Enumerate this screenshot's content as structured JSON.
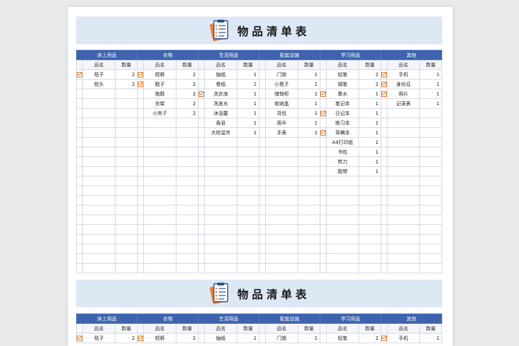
{
  "title": "物品清单表",
  "categories": [
    "床上用品",
    "衣物",
    "生活用品",
    "配套设施",
    "学习用品",
    "其他"
  ],
  "subheaders": {
    "name": "品名",
    "qty": "数量"
  },
  "rows": [
    [
      {
        "c": true,
        "n": "毯子",
        "q": "2"
      },
      {
        "c": true,
        "n": "短裤",
        "q": "2"
      },
      {
        "c": false,
        "n": "抽纸",
        "q": "1"
      },
      {
        "c": false,
        "n": "门锁",
        "q": "1"
      },
      {
        "c": false,
        "n": "铅笔",
        "q": "2"
      },
      {
        "c": true,
        "n": "手机",
        "q": "1"
      }
    ],
    [
      {
        "c": false,
        "n": "枕头",
        "q": "2"
      },
      {
        "c": true,
        "n": "鞋子",
        "q": "2"
      },
      {
        "c": false,
        "n": "卷纸",
        "q": "1"
      },
      {
        "c": false,
        "n": "小凳子",
        "q": "1"
      },
      {
        "c": false,
        "n": "钢笔",
        "q": "2"
      },
      {
        "c": true,
        "n": "身份证",
        "q": "1"
      }
    ],
    [
      {
        "c": false,
        "n": "",
        "q": ""
      },
      {
        "c": false,
        "n": "拖鞋",
        "q": "2"
      },
      {
        "c": true,
        "n": "洗衣液",
        "q": "1"
      },
      {
        "c": false,
        "n": "储物柜",
        "q": "1"
      },
      {
        "c": true,
        "n": "墨水",
        "q": "1"
      },
      {
        "c": true,
        "n": "照片",
        "q": "1"
      }
    ],
    [
      {
        "c": false,
        "n": "",
        "q": ""
      },
      {
        "c": false,
        "n": "衣架",
        "q": "2"
      },
      {
        "c": false,
        "n": "洗发水",
        "q": "1"
      },
      {
        "c": false,
        "n": "收纳盒",
        "q": "1"
      },
      {
        "c": false,
        "n": "笔记本",
        "q": "1"
      },
      {
        "c": false,
        "n": "记录表",
        "q": "1"
      }
    ],
    [
      {
        "c": false,
        "n": "",
        "q": ""
      },
      {
        "c": false,
        "n": "小夹子",
        "q": "2"
      },
      {
        "c": false,
        "n": "沐浴露",
        "q": "1"
      },
      {
        "c": false,
        "n": "背包",
        "q": "1"
      },
      {
        "c": true,
        "n": "日记本",
        "q": "1"
      },
      {
        "c": false,
        "n": "",
        "q": ""
      }
    ],
    [
      {
        "c": false,
        "n": "",
        "q": ""
      },
      {
        "c": false,
        "n": "",
        "q": ""
      },
      {
        "c": false,
        "n": "香皂",
        "q": "1"
      },
      {
        "c": false,
        "n": "雨伞",
        "q": "1"
      },
      {
        "c": false,
        "n": "练习本",
        "q": "1"
      },
      {
        "c": false,
        "n": "",
        "q": ""
      }
    ],
    [
      {
        "c": false,
        "n": "",
        "q": ""
      },
      {
        "c": false,
        "n": "",
        "q": ""
      },
      {
        "c": false,
        "n": "大绞溢市",
        "q": "1"
      },
      {
        "c": false,
        "n": "手表",
        "q": "1"
      },
      {
        "c": true,
        "n": "草稿本",
        "q": "1"
      },
      {
        "c": false,
        "n": "",
        "q": ""
      }
    ],
    [
      {
        "c": false,
        "n": "",
        "q": ""
      },
      {
        "c": false,
        "n": "",
        "q": ""
      },
      {
        "c": false,
        "n": "",
        "q": ""
      },
      {
        "c": false,
        "n": "",
        "q": ""
      },
      {
        "c": false,
        "n": "A4打印纸",
        "q": "1"
      },
      {
        "c": false,
        "n": "",
        "q": ""
      }
    ],
    [
      {
        "c": false,
        "n": "",
        "q": ""
      },
      {
        "c": false,
        "n": "",
        "q": ""
      },
      {
        "c": false,
        "n": "",
        "q": ""
      },
      {
        "c": false,
        "n": "",
        "q": ""
      },
      {
        "c": false,
        "n": "书包",
        "q": "1"
      },
      {
        "c": false,
        "n": "",
        "q": ""
      }
    ],
    [
      {
        "c": false,
        "n": "",
        "q": ""
      },
      {
        "c": false,
        "n": "",
        "q": ""
      },
      {
        "c": false,
        "n": "",
        "q": ""
      },
      {
        "c": false,
        "n": "",
        "q": ""
      },
      {
        "c": false,
        "n": "剪刀",
        "q": "1"
      },
      {
        "c": false,
        "n": "",
        "q": ""
      }
    ],
    [
      {
        "c": false,
        "n": "",
        "q": ""
      },
      {
        "c": false,
        "n": "",
        "q": ""
      },
      {
        "c": false,
        "n": "",
        "q": ""
      },
      {
        "c": false,
        "n": "",
        "q": ""
      },
      {
        "c": false,
        "n": "胶带",
        "q": "1"
      },
      {
        "c": false,
        "n": "",
        "q": ""
      }
    ]
  ],
  "empty_rows": 10,
  "second_rows": [
    [
      {
        "c": true,
        "n": "毯子",
        "q": "2"
      },
      {
        "c": true,
        "n": "短裤",
        "q": "2"
      },
      {
        "c": false,
        "n": "抽纸",
        "q": "1"
      },
      {
        "c": false,
        "n": "门锁",
        "q": "1"
      },
      {
        "c": false,
        "n": "铅笔",
        "q": "2"
      },
      {
        "c": true,
        "n": "手机",
        "q": "1"
      }
    ]
  ],
  "colors": {
    "header": "#3f64ae",
    "banner": "#dde8f5",
    "check": "#e07a2c"
  }
}
